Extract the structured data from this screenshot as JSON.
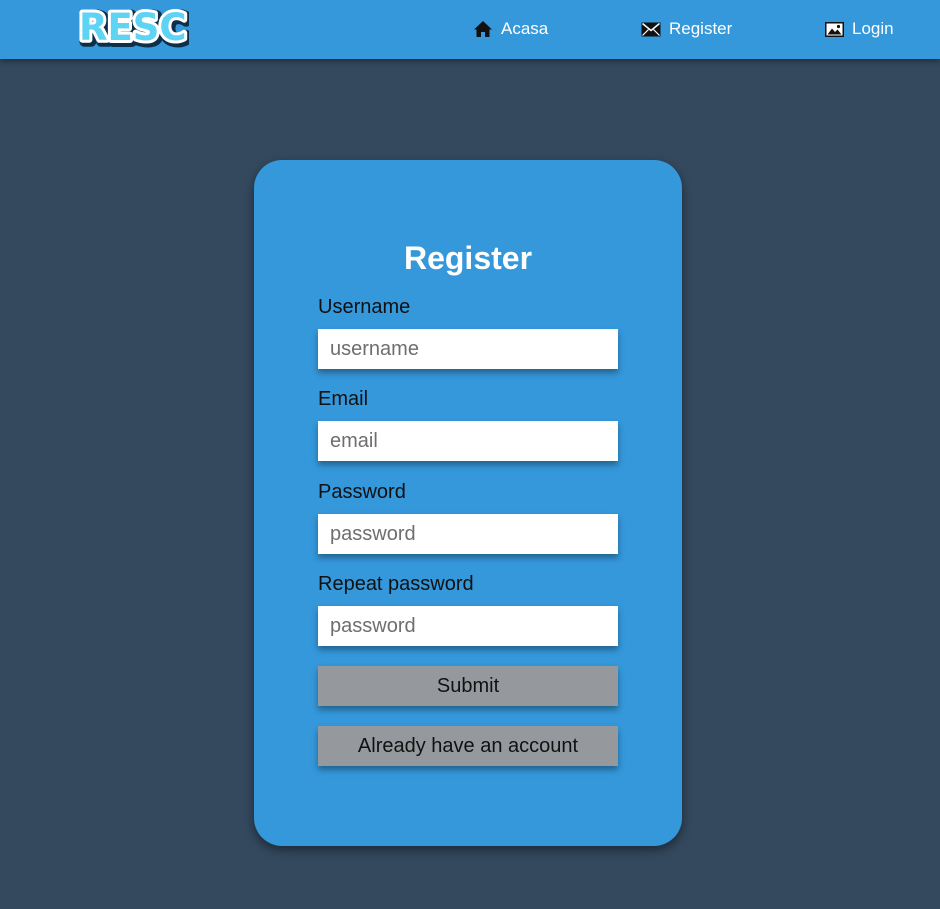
{
  "brand": {
    "logo_text": "RESC"
  },
  "nav": {
    "items": [
      {
        "label": "Acasa",
        "icon": "home-icon"
      },
      {
        "label": "Register",
        "icon": "envelope-icon"
      },
      {
        "label": "Login",
        "icon": "image-icon"
      }
    ]
  },
  "form": {
    "title": "Register",
    "fields": [
      {
        "label": "Username",
        "placeholder": "username",
        "value": ""
      },
      {
        "label": "Email",
        "placeholder": "email",
        "value": ""
      },
      {
        "label": "Password",
        "placeholder": "password",
        "value": ""
      },
      {
        "label": "Repeat password",
        "placeholder": "password",
        "value": ""
      }
    ],
    "submit_label": "Submit",
    "login_link_label": "Already have an account"
  },
  "colors": {
    "background": "#34495e",
    "accent": "#3498db",
    "button": "#95999e"
  }
}
